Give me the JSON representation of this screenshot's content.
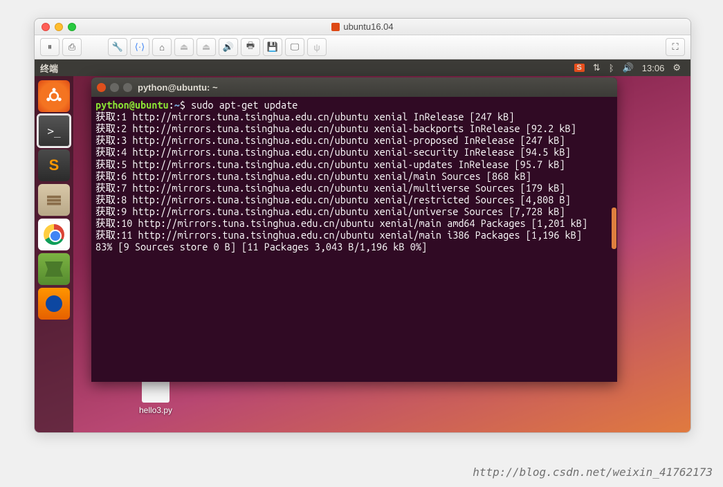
{
  "mac": {
    "title": "ubuntu16.04"
  },
  "ubuntu_topbar": {
    "menu": "终端",
    "time": "13:06",
    "sogou": "S"
  },
  "desktop": {
    "file1": "hello3.py"
  },
  "terminal": {
    "title": "python@ubuntu: ~",
    "prompt_user": "python@ubuntu",
    "prompt_sep": ":",
    "prompt_path": "~",
    "prompt_sym": "$ ",
    "command": "sudo apt-get update",
    "lines": [
      "获取:1 http://mirrors.tuna.tsinghua.edu.cn/ubuntu xenial InRelease [247 kB]",
      "获取:2 http://mirrors.tuna.tsinghua.edu.cn/ubuntu xenial-backports InRelease [92.2 kB]",
      "获取:3 http://mirrors.tuna.tsinghua.edu.cn/ubuntu xenial-proposed InRelease [247 kB]",
      "获取:4 http://mirrors.tuna.tsinghua.edu.cn/ubuntu xenial-security InRelease [94.5 kB]",
      "获取:5 http://mirrors.tuna.tsinghua.edu.cn/ubuntu xenial-updates InRelease [95.7 kB]",
      "获取:6 http://mirrors.tuna.tsinghua.edu.cn/ubuntu xenial/main Sources [868 kB]",
      "获取:7 http://mirrors.tuna.tsinghua.edu.cn/ubuntu xenial/multiverse Sources [179 kB]",
      "获取:8 http://mirrors.tuna.tsinghua.edu.cn/ubuntu xenial/restricted Sources [4,808 B]",
      "获取:9 http://mirrors.tuna.tsinghua.edu.cn/ubuntu xenial/universe Sources [7,728 kB]",
      "获取:10 http://mirrors.tuna.tsinghua.edu.cn/ubuntu xenial/main amd64 Packages [1,201 kB]",
      "获取:11 http://mirrors.tuna.tsinghua.edu.cn/ubuntu xenial/main i386 Packages [1,196 kB]",
      "83% [9 Sources store 0 B] [11 Packages 3,043 B/1,196 kB 0%]"
    ]
  },
  "watermark": "http://blog.csdn.net/weixin_41762173"
}
